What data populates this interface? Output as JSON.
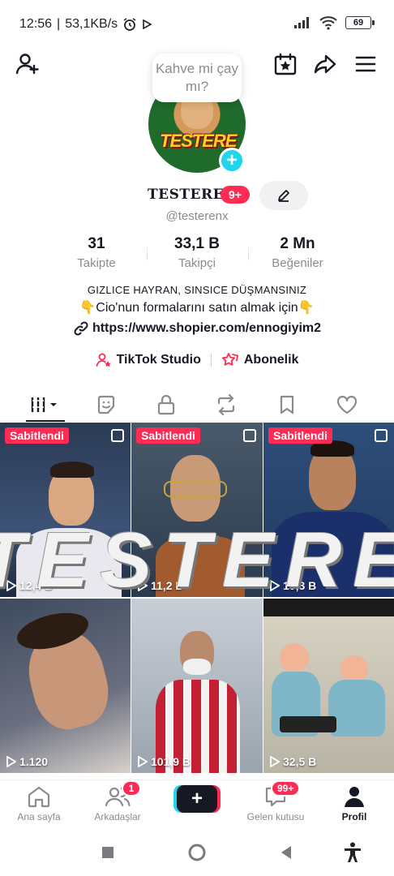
{
  "status_bar": {
    "time": "12:56",
    "speed": "53,1KB/s",
    "battery": "69"
  },
  "speech_bubble": "Kahve mi çay mı?",
  "profile": {
    "avatar_text": "TESTERE",
    "username": "TESTERE",
    "notification_count": "9+",
    "handle": "@testerenx"
  },
  "stats": [
    {
      "value": "31",
      "label": "Takipte"
    },
    {
      "value": "33,1 B",
      "label": "Takipçi"
    },
    {
      "value": "2 Mn",
      "label": "Beğeniler"
    }
  ],
  "bio": {
    "line1": "GIZLICE HAYRAN, SINSICE DÜŞMANSINIZ",
    "line2": "👇Cio'nun formalarını satın almak için👇",
    "link": "https://www.shopier.com/ennogiyim2"
  },
  "shortcuts": {
    "studio": "TikTok Studio",
    "subscription": "Abonelik"
  },
  "banner_text": "TESTERE",
  "videos": [
    {
      "pinned_label": "Sabitlendi",
      "views": "12,4 B"
    },
    {
      "pinned_label": "Sabitlendi",
      "views": "11,2 B"
    },
    {
      "pinned_label": "Sabitlendi",
      "views": "10,3 B"
    },
    {
      "views": "1.120"
    },
    {
      "views": "101,9 B"
    },
    {
      "views": "32,5 B"
    }
  ],
  "bottom_nav": {
    "home": "Ana sayfa",
    "friends": "Arkadaşlar",
    "friends_badge": "1",
    "inbox": "Gelen kutusu",
    "inbox_badge": "99+",
    "profile": "Profil"
  },
  "colors": {
    "accent_red": "#fe2c55",
    "accent_cyan": "#20d5ec",
    "text_primary": "#161823",
    "text_secondary": "#8a8b91"
  }
}
